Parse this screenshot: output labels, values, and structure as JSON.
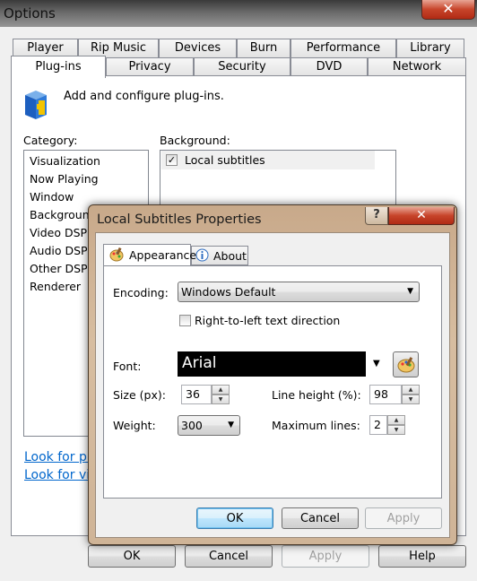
{
  "window": {
    "title": "Options",
    "close_glyph": "✕"
  },
  "tabs_row1": [
    "Player",
    "Rip Music",
    "Devices",
    "Burn",
    "Performance",
    "Library"
  ],
  "tabs_row2": [
    "Plug-ins",
    "Privacy",
    "Security",
    "DVD",
    "Network"
  ],
  "plugins_page": {
    "description": "Add and configure plug-ins.",
    "category_label": "Category:",
    "categories": [
      "Visualization",
      "Now Playing",
      "Window",
      "Background",
      "Video DSP",
      "Audio DSP",
      "Other DSP",
      "Renderer"
    ],
    "background_label": "Background:",
    "background_items": [
      {
        "label": "Local subtitles",
        "checked": true
      }
    ],
    "links": [
      "Look for pl",
      "Look for vi"
    ]
  },
  "footer": {
    "ok": "OK",
    "cancel": "Cancel",
    "apply": "Apply",
    "help": "Help"
  },
  "dialog": {
    "title": "Local Subtitles Properties",
    "help_glyph": "?",
    "close_glyph": "✕",
    "tabs": [
      "Appearance",
      "About"
    ],
    "encoding_label": "Encoding:",
    "encoding_value": "Windows Default",
    "rtl_label": "Right-to-left text direction",
    "rtl_checked": false,
    "font_label": "Font:",
    "font_value": "Arial",
    "size_label": "Size (px):",
    "size_value": "36",
    "line_height_label": "Line height (%):",
    "line_height_value": "98",
    "weight_label": "Weight:",
    "weight_value": "300",
    "max_lines_label": "Maximum lines:",
    "max_lines_value": "2",
    "ok": "OK",
    "cancel": "Cancel",
    "apply": "Apply"
  }
}
